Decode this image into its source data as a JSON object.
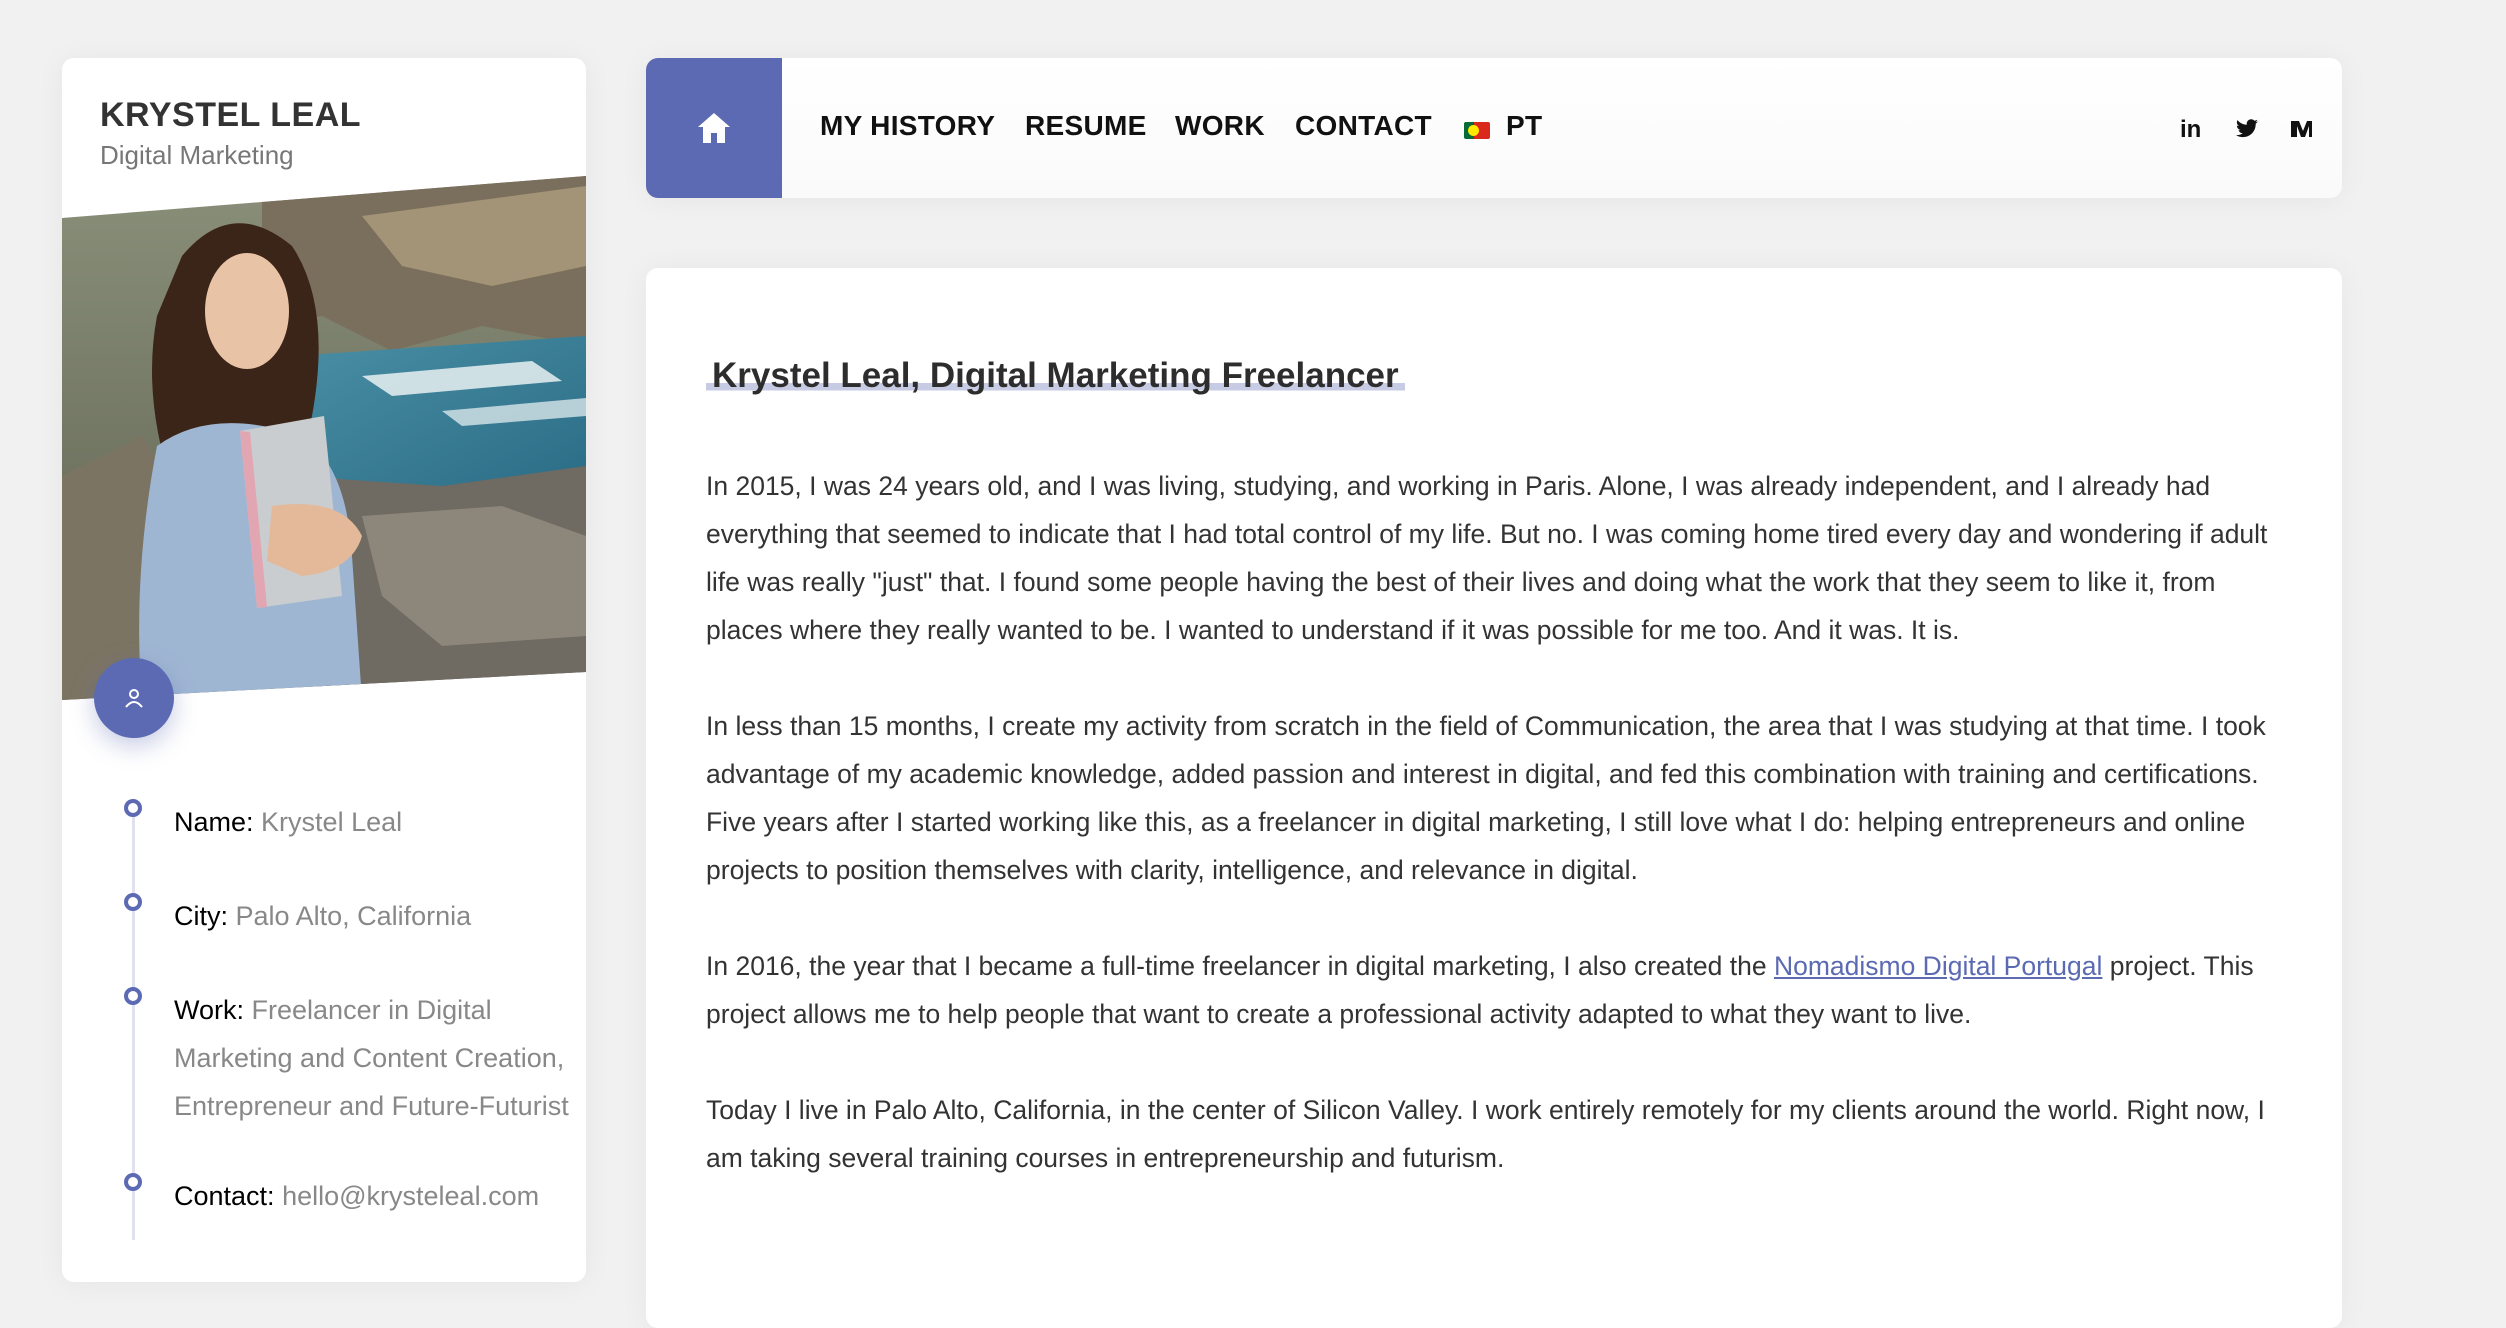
{
  "sidebar": {
    "name": "KRYSTEL LEAL",
    "role": "Digital Marketing",
    "info": [
      {
        "label": "Name:",
        "value": "Krystel Leal"
      },
      {
        "label": "City:",
        "value": "Palo Alto, California"
      },
      {
        "label": "Work:",
        "value": "Freelancer in Digital Marketing and Content Creation, Entrepreneur and Future-Futurist"
      },
      {
        "label": "Contact:",
        "value": "hello@krysteleal.com"
      }
    ]
  },
  "nav": {
    "items": [
      "MY HISTORY",
      "RESUME",
      "WORK",
      "CONTACT"
    ],
    "language": "PT",
    "social": {
      "linkedin": "in",
      "twitter": "twitter-icon",
      "medium": "medium-icon"
    }
  },
  "content": {
    "title": "Krystel Leal, Digital Marketing Freelancer",
    "p1": "In 2015, I was 24 years old, and I was living, studying, and working in Paris. Alone, I was already independent, and I already had everything that seemed to indicate that I had total control of my life. But no. I was coming home tired every day and wondering if adult life was really \"just\" that. I found some people having the best of their lives and doing what the work that they seem to like it, from places where they really wanted to be. I wanted to understand if it was possible for me too. And it was. It is.",
    "p2": "In less than 15 months, I create my activity from scratch in the field of Communication, the area that I was studying at that time. I took advantage of my academic knowledge, added passion and interest in digital, and fed this combination with training and certifications. Five years after I started working like this, as a freelancer in digital marketing, I still love what I do: helping entrepreneurs and online projects to position themselves with clarity, intelligence, and relevance in digital.",
    "p3_before": "In 2016, the year that I became a full-time freelancer in digital marketing, I also created the ",
    "p3_link": "Nomadismo Digital Portugal",
    "p3_after": " project. This project allows me to help people that want to create a professional activity adapted to what they want to live.",
    "p4": "Today I live in Palo Alto, California, in the center of Silicon Valley. I work entirely remotely for my clients around the world. Right now, I am taking several training courses in entrepreneurship and futurism."
  },
  "colors": {
    "accent": "#5b6ab2",
    "background": "#f1f1f1"
  }
}
